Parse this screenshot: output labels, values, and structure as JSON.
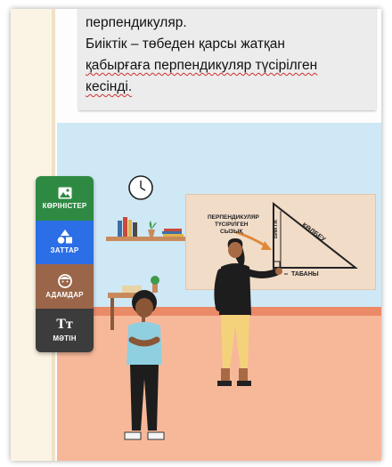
{
  "text_box": {
    "lines": [
      "перпендикуляр.",
      "Биіктік – төбеден қарсы жатқан",
      "қабырғаға перпендикуляр түсірілген",
      "кесінді."
    ]
  },
  "toolbar": {
    "items": [
      {
        "label": "КӨРІНІСТЕР",
        "icon": "image-icon",
        "color": "#2e8a42"
      },
      {
        "label": "ЗАТТАР",
        "icon": "shapes-icon",
        "color": "#2b6ee6"
      },
      {
        "label": "АДАМДАР",
        "icon": "face-icon",
        "color": "#9a6548"
      },
      {
        "label": "МӘТІН",
        "icon": "text-icon",
        "color": "#3c3c3c",
        "glyph": "Тт"
      }
    ]
  },
  "board": {
    "perpendicular_label_1": "ПЕРПЕНДИКУЛЯР",
    "perpendicular_label_2": "ТҮСІРІЛГЕН",
    "perpendicular_label_3": "СЫЗЫҚ",
    "height_label": "БИІКТІК",
    "hypotenuse_label": "КӨЛБЕУ",
    "base_label": "ТАБАНЫ"
  }
}
